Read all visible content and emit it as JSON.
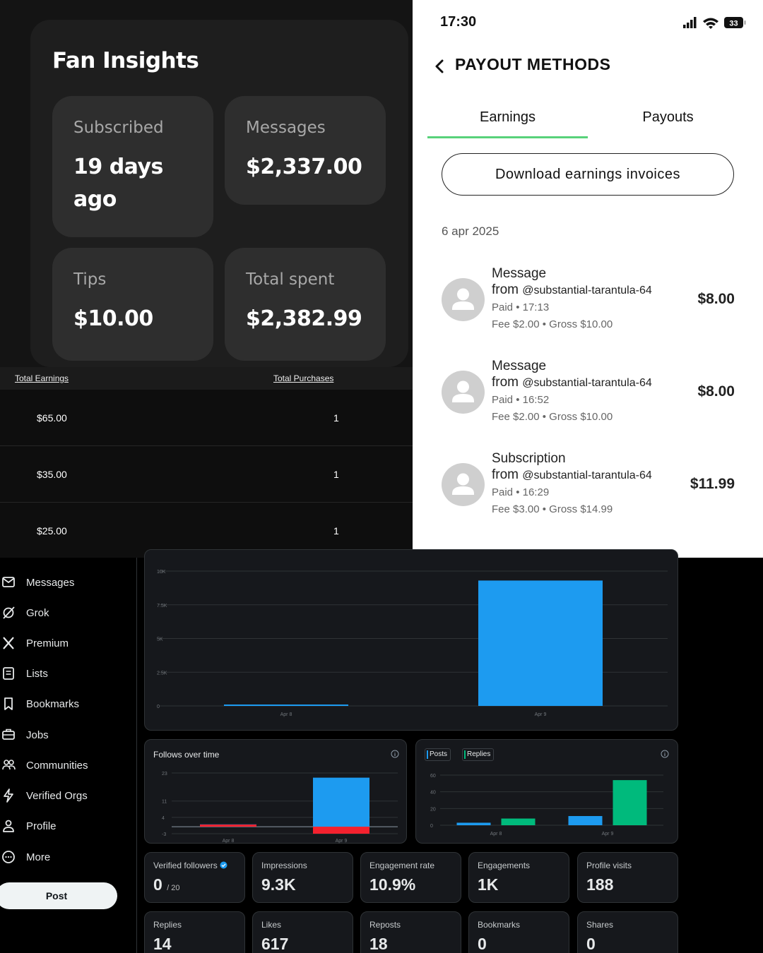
{
  "fan_insights": {
    "title": "Fan Insights",
    "tiles": [
      {
        "label": "Subscribed",
        "value": "19 days ago"
      },
      {
        "label": "Messages",
        "value": "$2,337.00"
      },
      {
        "label": "Tips",
        "value": "$10.00"
      },
      {
        "label": "Total spent",
        "value": "$2,382.99"
      }
    ]
  },
  "earnings_table": {
    "columns": [
      "Total Earnings",
      "Total Purchases"
    ],
    "rows": [
      {
        "earnings": "$65.00",
        "purchases": "1"
      },
      {
        "earnings": "$35.00",
        "purchases": "1"
      },
      {
        "earnings": "$25.00",
        "purchases": "1"
      }
    ]
  },
  "payout": {
    "status_time": "17:30",
    "battery": "33",
    "title": "PAYOUT METHODS",
    "tabs": [
      "Earnings",
      "Payouts"
    ],
    "active_tab": "Earnings",
    "download_label": "Download earnings invoices",
    "date": "6 apr 2025",
    "transactions": [
      {
        "type": "Message",
        "from_word": "from",
        "handle": "@substantial-tarantula-64",
        "paid": "Paid",
        "time": "17:13",
        "fee": "Fee $2.00",
        "gross": "Gross $10.00",
        "amount": "$8.00"
      },
      {
        "type": "Message",
        "from_word": "from",
        "handle": "@substantial-tarantula-64",
        "paid": "Paid",
        "time": "16:52",
        "fee": "Fee $2.00",
        "gross": "Gross $10.00",
        "amount": "$8.00"
      },
      {
        "type": "Subscription",
        "from_word": "from",
        "handle": "@substantial-tarantula-64",
        "paid": "Paid",
        "time": "16:29",
        "fee": "Fee $3.00",
        "gross": "Gross $14.99",
        "amount": "$11.99"
      }
    ]
  },
  "sidebar": {
    "items": [
      {
        "label": "Messages",
        "icon": "envelope-icon"
      },
      {
        "label": "Grok",
        "icon": "grok-icon"
      },
      {
        "label": "Premium",
        "icon": "x-logo-icon"
      },
      {
        "label": "Lists",
        "icon": "list-icon"
      },
      {
        "label": "Bookmarks",
        "icon": "bookmark-icon"
      },
      {
        "label": "Jobs",
        "icon": "briefcase-icon"
      },
      {
        "label": "Communities",
        "icon": "people-icon"
      },
      {
        "label": "Verified Orgs",
        "icon": "lightning-icon"
      },
      {
        "label": "Profile",
        "icon": "person-icon"
      },
      {
        "label": "More",
        "icon": "more-circle-icon"
      }
    ],
    "post_label": "Post"
  },
  "stats": {
    "row1": [
      {
        "label": "Verified followers",
        "value": "0",
        "sub": "/ 20"
      },
      {
        "label": "Impressions",
        "value": "9.3K"
      },
      {
        "label": "Engagement rate",
        "value": "10.9%"
      },
      {
        "label": "Engagements",
        "value": "1K"
      },
      {
        "label": "Profile visits",
        "value": "188"
      }
    ],
    "row2": [
      {
        "label": "Replies",
        "value": "14"
      },
      {
        "label": "Likes",
        "value": "617"
      },
      {
        "label": "Reposts",
        "value": "18"
      },
      {
        "label": "Bookmarks",
        "value": "0"
      },
      {
        "label": "Shares",
        "value": "0"
      }
    ]
  },
  "colors": {
    "blue": "#1d9bf0",
    "red": "#f4212e",
    "green": "#00ba7c",
    "tab_underline": "#58d27a"
  },
  "chart_data": [
    {
      "type": "bar",
      "categories": [
        "Apr 8",
        "Apr 9"
      ],
      "series": [
        {
          "values": [
            50,
            9300
          ]
        }
      ],
      "yticks": [
        "10K",
        "7.5K",
        "5K",
        "2.5K",
        "0"
      ],
      "ylim": [
        0,
        10000
      ]
    },
    {
      "type": "bar",
      "title": "Follows over time",
      "categories": [
        "Apr 8",
        "Apr 9"
      ],
      "series": [
        {
          "values": [
            1,
            21
          ]
        },
        {
          "values": [
            0,
            -3
          ]
        }
      ],
      "yticks": [
        "23",
        "11",
        "4",
        "-3"
      ],
      "ylim": [
        -3,
        23
      ]
    },
    {
      "type": "bar",
      "categories": [
        "Apr 8",
        "Apr 9"
      ],
      "series": [
        {
          "name": "Posts",
          "values": [
            3,
            11
          ]
        },
        {
          "name": "Replies",
          "values": [
            8,
            54
          ]
        }
      ],
      "yticks": [
        "60",
        "40",
        "20",
        "0"
      ],
      "ylim": [
        0,
        60
      ]
    }
  ]
}
